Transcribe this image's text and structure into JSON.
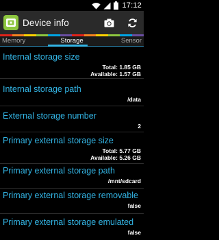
{
  "status_bar": {
    "time": "17:12",
    "icons": [
      "wifi-icon",
      "signal-icon",
      "battery-icon"
    ]
  },
  "action_bar": {
    "title": "Device info",
    "icons": [
      "app-logo-icon",
      "camera-icon",
      "refresh-icon"
    ]
  },
  "colors": {
    "accent": "#33b5e5",
    "app_icon": "#8dc63f",
    "rainbow": [
      "#e2231a",
      "#f58220",
      "#ffd200",
      "#8dc63f",
      "#00a4e4",
      "#6a4ea1",
      "#e2231a",
      "#f58220",
      "#ffd200",
      "#8dc63f",
      "#00a4e4",
      "#6a4ea1"
    ]
  },
  "tabs": {
    "left": "Memory",
    "active": "Storage",
    "right": "Sensor"
  },
  "items": [
    {
      "title": "Internal storage size",
      "value_line1": "Total: 1.85 GB",
      "value_line2": "Available: 1.57 GB"
    },
    {
      "title": "Internal storage path",
      "value_line1": "/data"
    },
    {
      "title": "External storage number",
      "value_line1": "2"
    },
    {
      "title": "Primary external storage size",
      "value_line1": "Total: 5.77 GB",
      "value_line2": "Available: 5.26 GB"
    },
    {
      "title": "Primary external storage path",
      "value_line1": "/mnt/sdcard"
    },
    {
      "title": "Primary external storage removable",
      "value_line1": "false"
    },
    {
      "title": "Primary external storage emulated",
      "value_line1": "false"
    }
  ]
}
